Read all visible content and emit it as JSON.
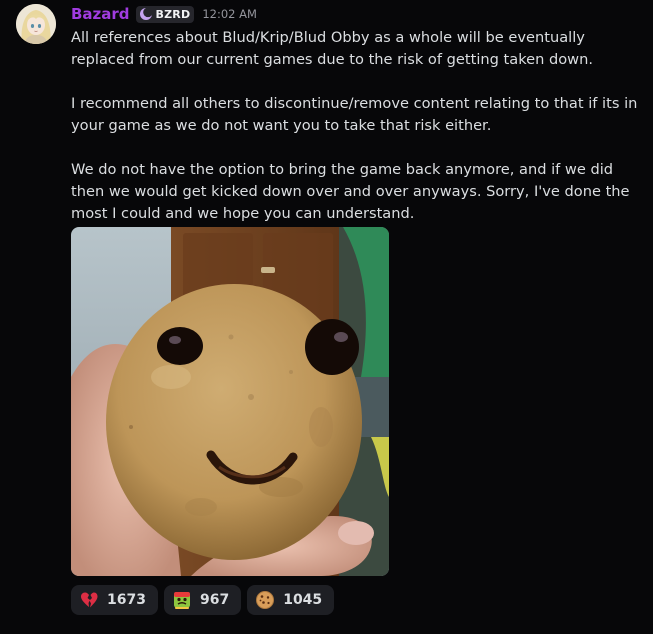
{
  "message": {
    "author": {
      "name": "Bazard",
      "avatar_icon": "anime-avatar-icon",
      "name_color": "#a03ce0"
    },
    "server_tag": {
      "icon": "moon-tag-icon",
      "label": "BZRD"
    },
    "timestamp": "12:02 AM",
    "paragraphs": [
      "All references about Blud/Krip/Blud Obby as a whole will be eventually replaced from our current games due to the risk of getting taken down.",
      "I recommend all others to discontinue/remove content relating to that if its in your game as we do not want you to take that risk either.",
      "We do not have the option to bring the game back anymore, and if we did then we would get kicked down over and over anyways. Sorry, I've done the most I could and we hope you can understand."
    ],
    "attachment": {
      "type": "image",
      "subject": "cookie-with-face-photo"
    },
    "reactions": [
      {
        "icon": "broken-heart-icon",
        "count": "1673"
      },
      {
        "icon": "nauseated-face-icon",
        "count": "967"
      },
      {
        "icon": "cookie-icon",
        "count": "1045"
      }
    ]
  }
}
